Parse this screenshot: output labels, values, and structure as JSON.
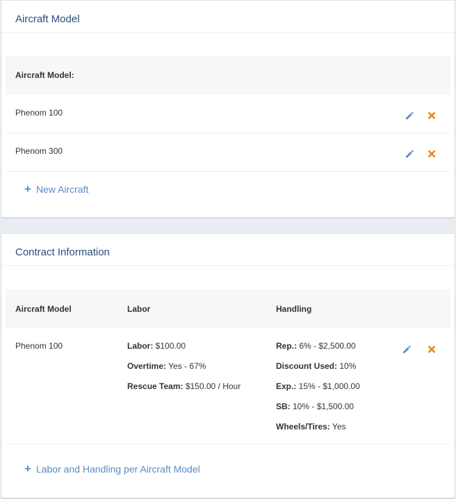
{
  "aircraft_section": {
    "title": "Aircraft Model",
    "table_header": "Aircraft Model:",
    "rows": [
      {
        "name": "Phenom 100"
      },
      {
        "name": "Phenom 300"
      }
    ],
    "add_label": "New Aircraft"
  },
  "contract_section": {
    "title": "Contract Information",
    "headers": {
      "model": "Aircraft Model",
      "labor": "Labor",
      "handling": "Handling"
    },
    "rows": [
      {
        "model": "Phenom 100",
        "labor": [
          {
            "key": "Labor:",
            "value": " $100.00"
          },
          {
            "key": "Overtime:",
            "value": " Yes - 67%"
          },
          {
            "key": "Rescue Team:",
            "value": " $150.00 / Hour"
          }
        ],
        "handling": [
          {
            "key": "Rep.:",
            "value": " 6% - $2,500.00"
          },
          {
            "key": "Discount Used:",
            "value": " 10%"
          },
          {
            "key": "Exp.:",
            "value": " 15% - $1,000.00"
          },
          {
            "key": "SB:",
            "value": " 10% - $1,500.00"
          },
          {
            "key": "Wheels/Tires:",
            "value": " Yes"
          }
        ]
      }
    ],
    "add_label": "Labor and Handling per Aircraft Model"
  },
  "colors": {
    "edit_icon": "#5b8ac6",
    "delete_icon": "#e8890c",
    "title": "#2b4c7e",
    "link": "#5b8ac6"
  },
  "icons": {
    "edit": "pencil-icon",
    "delete": "close-icon",
    "add": "plus-icon"
  }
}
